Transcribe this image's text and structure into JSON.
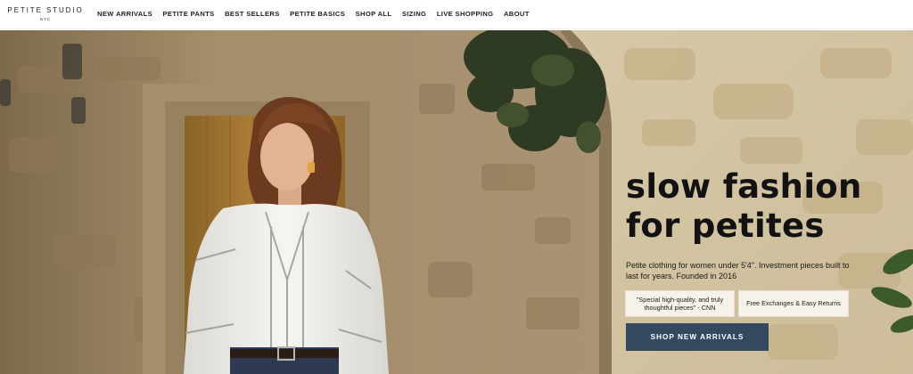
{
  "brand": {
    "name": "PETITE STUDIO",
    "location": "NYC"
  },
  "nav": {
    "items": [
      {
        "label": "NEW ARRIVALS"
      },
      {
        "label": "PETITE PANTS"
      },
      {
        "label": "BEST SELLERS"
      },
      {
        "label": "PETITE BASICS"
      },
      {
        "label": "SHOP ALL"
      },
      {
        "label": "SIZING"
      },
      {
        "label": "LIVE SHOPPING"
      },
      {
        "label": "ABOUT"
      }
    ]
  },
  "hero": {
    "headline_line1": "slow fashion",
    "headline_line2": "for petites",
    "subtext": "Petite clothing for women under 5'4\". Investment pieces built to last for years. Founded in 2016",
    "press_quote": "\"Special high-quality, and truly thoughtful pieces\" - CNN",
    "returns_badge": "Free Exchanges & Easy Returns",
    "cta_label": "SHOP NEW ARRIVALS"
  },
  "colors": {
    "cta_background": "#34485f",
    "badge_background": "#f7f3ea",
    "text": "#121212"
  }
}
